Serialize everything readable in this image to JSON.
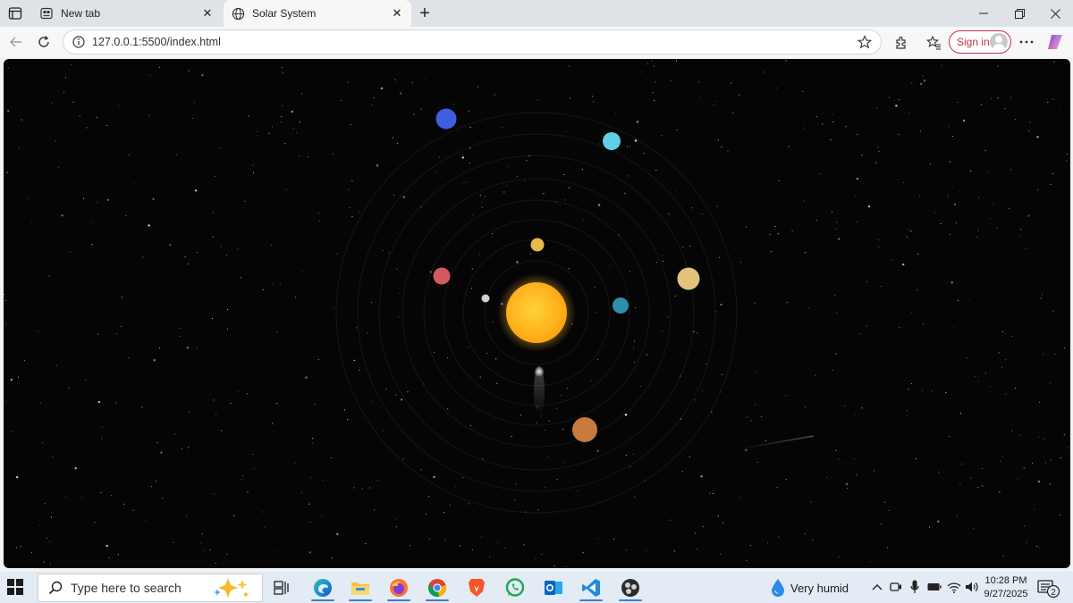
{
  "browser": {
    "tabs": [
      {
        "title": "New tab",
        "icon": "new-tab-icon",
        "active": false
      },
      {
        "title": "Solar System",
        "icon": "globe-icon",
        "active": true
      }
    ],
    "address": {
      "url": "127.0.0.1:5500/index.html"
    },
    "signin_label": "Sign in"
  },
  "page": {
    "background": "#050506",
    "planets": [
      {
        "name": "mercury",
        "color": "#cfcfcf"
      },
      {
        "name": "venus",
        "color": "#e8b84a"
      },
      {
        "name": "earth",
        "color": "#2e8fa8"
      },
      {
        "name": "mars",
        "color": "#d15a62"
      },
      {
        "name": "jupiter",
        "color": "#e3c27a"
      },
      {
        "name": "saturn",
        "color": "#c77b3a"
      },
      {
        "name": "uranus",
        "color": "#5fd0e6"
      },
      {
        "name": "neptune",
        "color": "#3f5fe0"
      }
    ],
    "sun_color": "#ffb81f"
  },
  "taskbar": {
    "search_placeholder": "Type here to search",
    "apps": [
      "task-view",
      "edge",
      "file-explorer",
      "firefox",
      "chrome",
      "brave",
      "whatsapp",
      "outlook",
      "vscode",
      "obs"
    ],
    "weather": "Very humid",
    "time": "10:28 PM",
    "date": "9/27/2025",
    "notification_count": "2"
  },
  "colors": {
    "accent": "#3b7fd6",
    "signin": "#c4314b"
  }
}
